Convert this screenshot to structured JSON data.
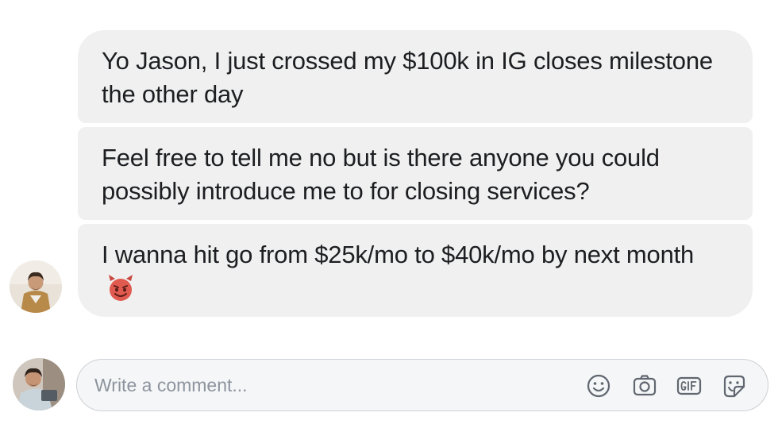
{
  "messages": [
    {
      "text": "Yo Jason, I just crossed my $100k in IG closes milestone the other day"
    },
    {
      "text": "Feel free to tell me no but is there anyone you could possibly introduce me to for closing services?"
    },
    {
      "text": "I wanna hit go from $25k/mo to $40k/mo by next month"
    }
  ],
  "message_emoji": "smiling-devil-emoji",
  "composer": {
    "placeholder": "Write a comment...",
    "icons": [
      "emoji-icon",
      "camera-icon",
      "gif-icon",
      "sticker-icon"
    ]
  },
  "colors": {
    "bubble": "#f0f0f0",
    "composer_border": "#ccd0d5",
    "icon": "#606770",
    "devil": "#e05a4f"
  }
}
